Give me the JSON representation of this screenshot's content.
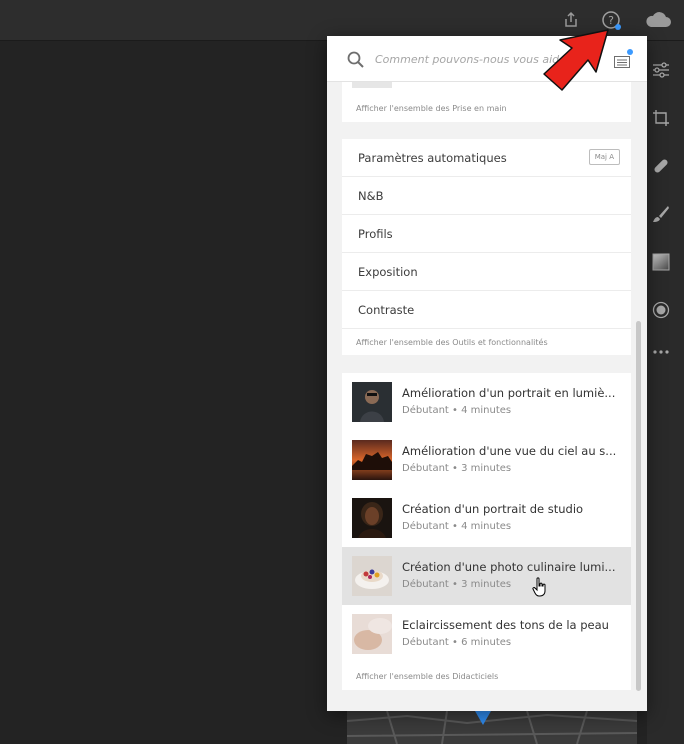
{
  "search": {
    "placeholder": "Comment pouvons-nous vous aider ?"
  },
  "getting_started": {
    "see_all": "Afficher l'ensemble des Prise en main"
  },
  "tools": {
    "items": [
      {
        "label": "Paramètres automatiques",
        "shortcut": "Maj A"
      },
      {
        "label": "N&B"
      },
      {
        "label": "Profils"
      },
      {
        "label": "Exposition"
      },
      {
        "label": "Contraste"
      }
    ],
    "see_all": "Afficher l'ensemble des Outils et fonctionnalités"
  },
  "tutorials": {
    "items": [
      {
        "title": "Amélioration d'un portrait en lumiè...",
        "meta": "Débutant • 4 minutes"
      },
      {
        "title": "Amélioration d'une vue du ciel au s...",
        "meta": "Débutant • 3 minutes"
      },
      {
        "title": "Création d'un portrait de studio",
        "meta": "Débutant • 4 minutes"
      },
      {
        "title": "Création d'une photo culinaire lumi...",
        "meta": "Débutant • 3 minutes"
      },
      {
        "title": "Eclaircissement des tons de la peau",
        "meta": "Débutant • 6 minutes"
      }
    ],
    "see_all": "Afficher l'ensemble des Didacticiels"
  },
  "colors": {
    "accent": "#3b9aff",
    "arrow": "#e8231b"
  },
  "icons": [
    "share-icon",
    "help-icon",
    "cloud-icon",
    "search-icon",
    "whats-new-icon",
    "adjust-sliders-icon",
    "crop-icon",
    "healing-icon",
    "brush-icon",
    "gradient-icon",
    "radial-icon",
    "more-icon"
  ]
}
